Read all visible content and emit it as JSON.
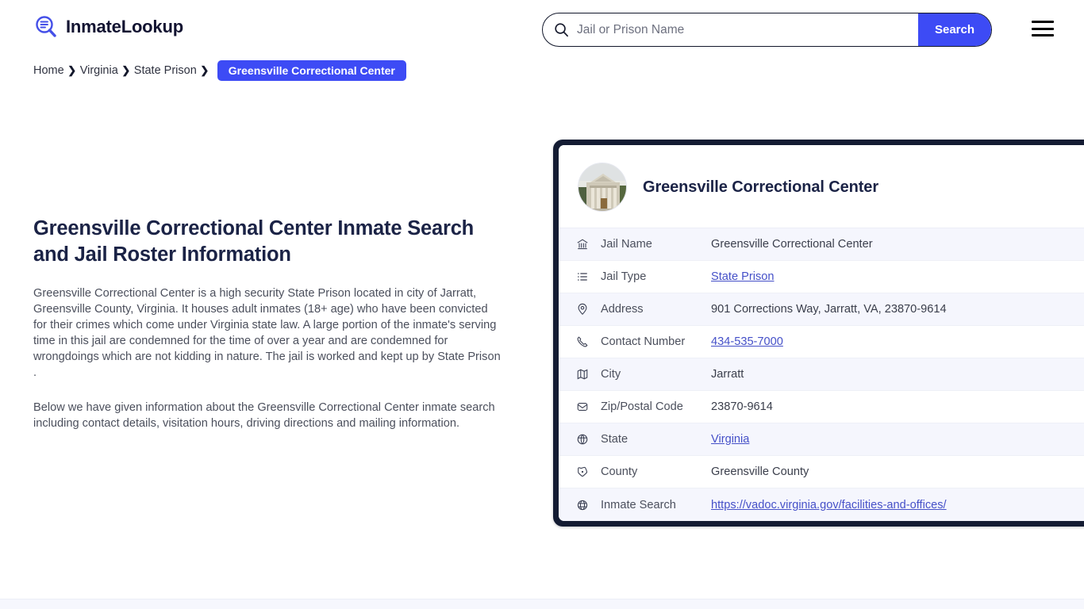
{
  "header": {
    "brand_name": "InmateLookup",
    "brand_icon": "search-list-icon",
    "menu_icon": "hamburger-menu-icon"
  },
  "search": {
    "icon": "search-icon",
    "placeholder": "Jail or Prison Name",
    "value": "",
    "button_label": "Search"
  },
  "breadcrumb": {
    "separator": "❯",
    "items": [
      {
        "label": "Home"
      },
      {
        "label": "Virginia"
      },
      {
        "label": "State Prison"
      }
    ],
    "current": "Greensville Correctional Center"
  },
  "article": {
    "heading": "Greensville Correctional Center Inmate Search and Jail Roster Information",
    "paragraph1": "Greensville Correctional Center is a high security State Prison located in city of Jarratt, Greensville County, Virginia. It houses adult inmates (18+ age) who have been convicted for their crimes which come under Virginia state law. A large portion of the inmate's serving time in this jail are condemned for the time of over a year and are condemned for wrongdoings which are not kidding in nature. The jail is worked and kept up by State Prison .",
    "paragraph2": "Below we have given information about the Greensville Correctional Center inmate search including contact details, visitation hours, driving directions and mailing information."
  },
  "card": {
    "thumbnail_icon": "courthouse-photo",
    "title": "Greensville Correctional Center",
    "rows": [
      {
        "icon": "bank-icon",
        "label": "Jail Name",
        "value": "Greensville Correctional Center",
        "link": false
      },
      {
        "icon": "list-icon",
        "label": "Jail Type",
        "value": "State Prison",
        "link": true
      },
      {
        "icon": "map-pin-icon",
        "label": "Address",
        "value": "901 Corrections Way, Jarratt, VA, 23870-9614",
        "link": false
      },
      {
        "icon": "phone-icon",
        "label": "Contact Number",
        "value": "434-535-7000",
        "link": true
      },
      {
        "icon": "map-icon",
        "label": "City",
        "value": "Jarratt",
        "link": false
      },
      {
        "icon": "envelope-icon",
        "label": "Zip/Postal Code",
        "value": "23870-9614",
        "link": false
      },
      {
        "icon": "globe-icon",
        "label": "State",
        "value": "Virginia",
        "link": true
      },
      {
        "icon": "region-icon",
        "label": "County",
        "value": "Greensville County",
        "link": false
      },
      {
        "icon": "www-globe-icon",
        "label": "Inmate Search",
        "value": "https://vadoc.virginia.gov/facilities-and-offices/",
        "link": true
      }
    ]
  },
  "colors": {
    "accent_blue": "#3d4bf5",
    "dark_navy": "#141c33",
    "heading_navy": "#1b2346",
    "row_alt_bg": "#f5f6fd",
    "link_blue": "#4550c8"
  }
}
